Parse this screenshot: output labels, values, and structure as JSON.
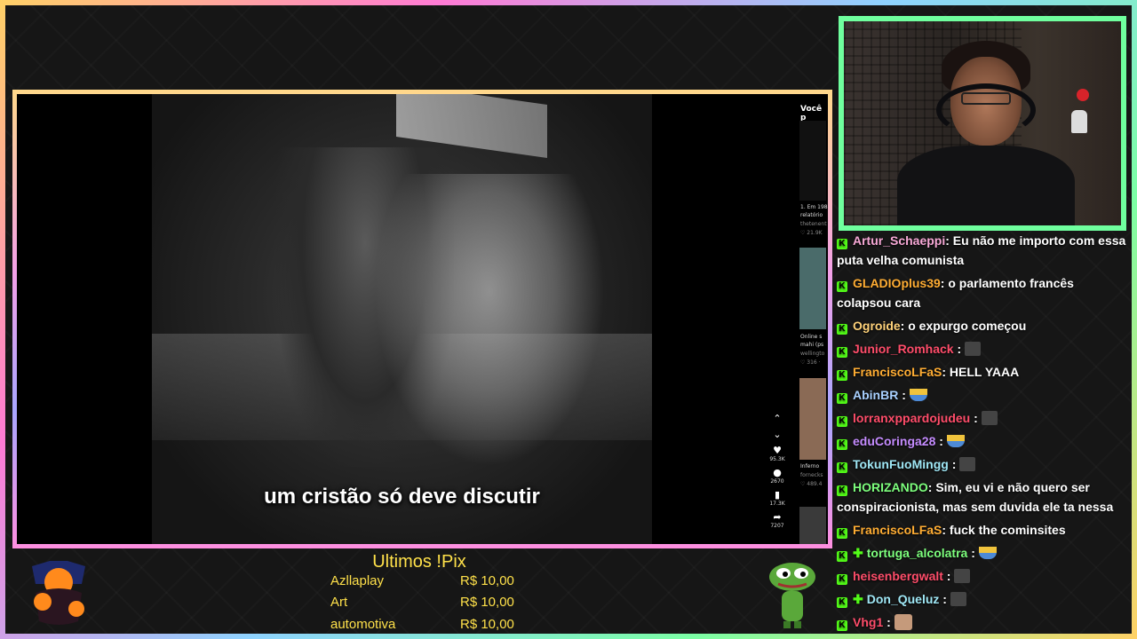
{
  "video": {
    "subtitle": "um cristão só deve discutir",
    "side_panel": {
      "title": "Você p",
      "items": [
        {
          "line1": "1. Em 198",
          "line2": "relatório",
          "line3": "thetenent",
          "likes": "♡ 21.9K"
        },
        {
          "line1": "Online s",
          "line2": "mahi (ps",
          "line3": "wellingto",
          "likes": "♡ 316 ·"
        },
        {
          "line1": "Inferno",
          "line2": "",
          "line3": "fornecks",
          "likes": "♡ 489.4"
        }
      ]
    },
    "actions": {
      "likes": "95.3K",
      "comments": "2670",
      "saves": "17.3K",
      "shares": "7207"
    }
  },
  "chat": {
    "messages": [
      {
        "user": "Artur_Schaeppi",
        "color": "#f7a8d6",
        "text": ": Eu não me importo com essa puta velha comunista",
        "emote": ""
      },
      {
        "user": "GLADIOplus39",
        "color": "#ffad33",
        "text": ": o parlamento francês colapsou cara",
        "emote": ""
      },
      {
        "user": "Ogroide",
        "color": "#ffd27a",
        "text": ": o expurgo começou",
        "emote": ""
      },
      {
        "user": "Junior_Romhack",
        "color": "#ff4d6a",
        "text": " :",
        "emote": "gray"
      },
      {
        "user": "FranciscoLFaS",
        "color": "#ffad33",
        "text": ": HELL YAAA",
        "emote": ""
      },
      {
        "user": "AbinBR",
        "color": "#a8d0ff",
        "text": " :",
        "emote": "boat"
      },
      {
        "user": "lorranxppardojudeu",
        "color": "#ff4d6a",
        "text": " :",
        "emote": "gray"
      },
      {
        "user": "eduCoringa28",
        "color": "#c58cff",
        "text": " :",
        "emote": "boat"
      },
      {
        "user": "TokunFuoMingg",
        "color": "#9fe7f5",
        "text": " :",
        "emote": "gray"
      },
      {
        "user": "HORIZANDO",
        "color": "#7dff7d",
        "text": ": Sim, eu vi e não quero ser conspiracionista, mas sem duvida ele ta nessa",
        "emote": ""
      },
      {
        "user": "FranciscoLFaS",
        "color": "#ffad33",
        "text": ": fuck the cominsites",
        "emote": ""
      },
      {
        "user": "tortuga_alcolatra",
        "color": "#7dff7d",
        "text": " :",
        "emote": "boat",
        "plus": true
      },
      {
        "user": "heisenbergwalt",
        "color": "#ff4d6a",
        "text": " :",
        "emote": "gray"
      },
      {
        "user": "Don_Queluz",
        "color": "#9fe7f5",
        "text": " :",
        "emote": "gray",
        "plus": true
      },
      {
        "user": "Vhg1",
        "color": "#ff4d6a",
        "text": " :",
        "emote": "face"
      }
    ]
  },
  "pix": {
    "title": "Ultimos !Pix",
    "entries": [
      {
        "name": "Azllaplay",
        "value": "R$ 10,00"
      },
      {
        "name": "Art",
        "value": "R$ 10,00"
      },
      {
        "name": "automotiva",
        "value": "R$ 10,00"
      }
    ]
  },
  "colors": {
    "kick_green": "#53fc18",
    "cam_border": "#6fff9e",
    "pix_yellow": "#ffe14a"
  }
}
